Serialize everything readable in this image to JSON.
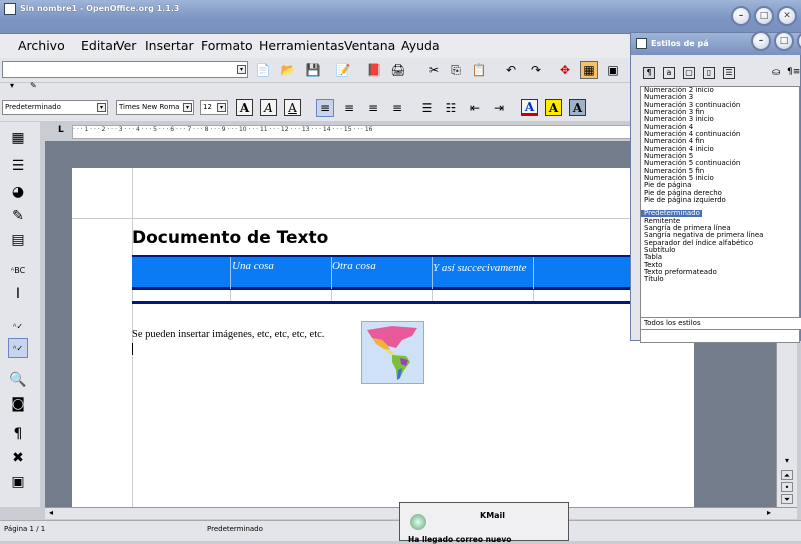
{
  "window": {
    "title": "Sin nombre1 - OpenOffice.org 1.1.3"
  },
  "menu": [
    "Archivo",
    "Editar",
    "Ver",
    "Insertar",
    "Formato",
    "Herramientas",
    "Ventana",
    "Ayuda"
  ],
  "format": {
    "style": "Predeterminado",
    "font": "Times New Roma",
    "size": "12"
  },
  "ruler_marks": "· · · 1 · · · 2 · · · 3 · · · 4 · · · 5 · · · 6 · · · 7 · · · 8 · · · 9 · · · 10 · · · 11 · · · 12 · · · 13 · · · 14 · · · 15 · · · 16",
  "document": {
    "heading": "Documento de Texto",
    "table_headers": [
      "Una cosa",
      "Otra cosa",
      "Y así succecivamente",
      ""
    ],
    "body_text": "Se pueden insertar imágenes, etc, etc, etc, etc."
  },
  "styles_panel": {
    "title": "Estilos de pá",
    "items": [
      "Numeración 2 inicio",
      "Numeración 3",
      "Numeración 3 continuación",
      "Numeración 3 fin",
      "Numeración 3 inicio",
      "Numeración 4",
      "Numeración 4 continuación",
      "Numeración 4 fin",
      "Numeración 4 inicio",
      "Numeración 5",
      "Numeración 5 continuación",
      "Numeración 5 fin",
      "Numeración 5 inicio",
      "Pie de página",
      "Pie de página derecho",
      "Pie de página izquierdo",
      "Predeterminado",
      "Remitente",
      "Sangría de primera línea",
      "Sangría negativa de primera línea",
      "Separador del índice alfabético",
      "Subtítulo",
      "Tabla",
      "Texto",
      "Texto preformateado",
      "Título"
    ],
    "selected_index": 16,
    "filter": "Todos los estilos"
  },
  "status": {
    "page": "Página  1 / 1",
    "style": "Predeterminado"
  },
  "kmail": {
    "title": "KMail",
    "message": "Ha llegado correo nuevo"
  }
}
